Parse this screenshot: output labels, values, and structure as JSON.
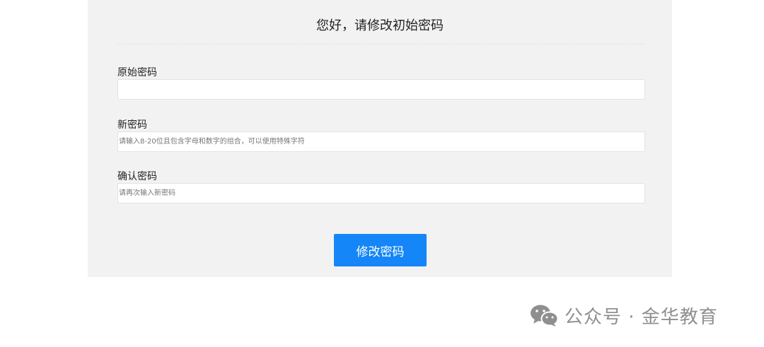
{
  "form": {
    "title": "您好，请修改初始密码",
    "fields": [
      {
        "label": "原始密码",
        "value": "",
        "placeholder": ""
      },
      {
        "label": "新密码",
        "value": "",
        "placeholder": "请输入8-20位且包含字母和数字的组合，可以使用特殊字符"
      },
      {
        "label": "确认密码",
        "value": "",
        "placeholder": "请再次输入新密码"
      }
    ],
    "submit_label": "修改密码"
  },
  "watermark": {
    "icon": "wechat-icon",
    "text": "公众号 · 金华教育"
  },
  "colors": {
    "panel_bg": "#f2f2f2",
    "button_bg": "#1486f7",
    "watermark": "#8f8f8f"
  }
}
